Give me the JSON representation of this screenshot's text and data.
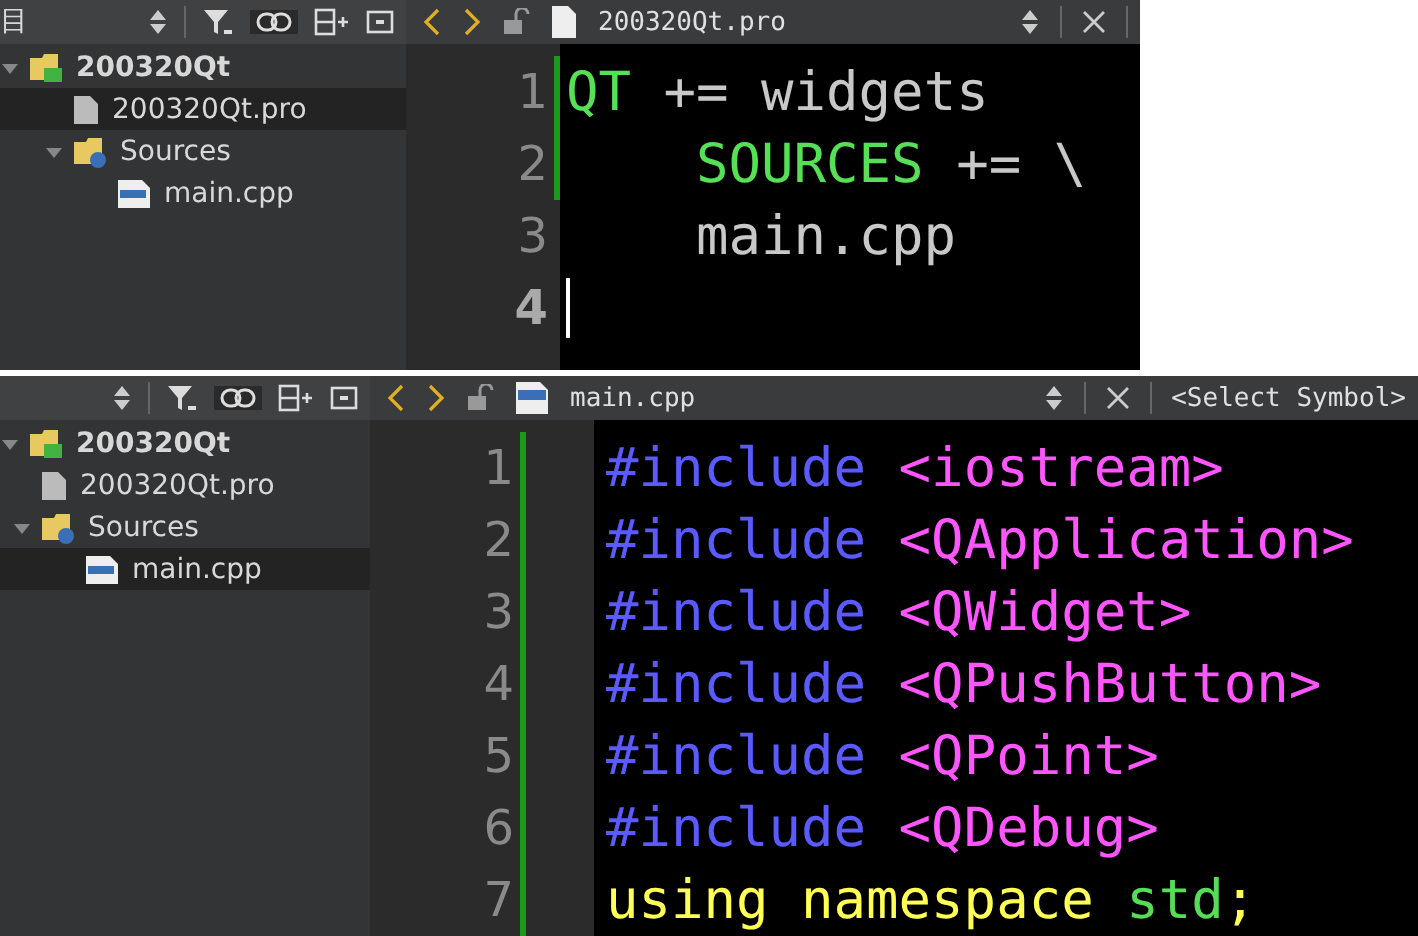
{
  "panels": [
    {
      "sidebar": {
        "title": "目",
        "tree": [
          {
            "label": "200320Qt",
            "kind": "project",
            "selected": false,
            "expanded": true,
            "children": [
              {
                "label": "200320Qt.pro",
                "kind": "pro-file",
                "selected": true
              },
              {
                "label": "Sources",
                "kind": "sources-folder",
                "selected": false,
                "expanded": true,
                "children": [
                  {
                    "label": "main.cpp",
                    "kind": "cpp-file",
                    "selected": false
                  }
                ]
              }
            ]
          }
        ]
      },
      "editor": {
        "file": "200320Qt.pro",
        "kind": "pro",
        "lines": [
          {
            "number": "1",
            "current": false,
            "modified": true,
            "segments": [
              {
                "text": "QT",
                "color": "#55e055"
              },
              {
                "text": " += widgets",
                "color": "#c8c8c8"
              }
            ]
          },
          {
            "number": "2",
            "current": false,
            "modified": true,
            "segments": [
              {
                "text": "    SOURCES",
                "color": "#55e055"
              },
              {
                "text": " += \\",
                "color": "#c8c8c8"
              }
            ]
          },
          {
            "number": "3",
            "current": false,
            "modified": false,
            "segments": [
              {
                "text": "    main.cpp",
                "color": "#c8c8c8"
              }
            ]
          },
          {
            "number": "4",
            "current": true,
            "modified": false
          }
        ]
      }
    },
    {
      "sidebar": {
        "tree": [
          {
            "label": "200320Qt",
            "kind": "project",
            "selected": false,
            "expanded": true,
            "children": [
              {
                "label": "200320Qt.pro",
                "kind": "pro-file",
                "selected": false
              },
              {
                "label": "Sources",
                "kind": "sources-folder",
                "selected": false,
                "expanded": true,
                "children": [
                  {
                    "label": "main.cpp",
                    "kind": "cpp-file",
                    "selected": true
                  }
                ]
              }
            ]
          }
        ]
      },
      "editor": {
        "file": "main.cpp",
        "kind": "cpp",
        "symbol_selector": "<Select Symbol>",
        "lines": [
          {
            "number": "1",
            "current": false,
            "modified": true,
            "segments": [
              {
                "text": "#include",
                "color": "#5a5aff"
              },
              {
                "text": " <iostream>",
                "color": "#ff55ff"
              }
            ]
          },
          {
            "number": "2",
            "current": false,
            "modified": true,
            "segments": [
              {
                "text": "#include",
                "color": "#5a5aff"
              },
              {
                "text": " <QApplication>",
                "color": "#ff55ff"
              }
            ]
          },
          {
            "number": "3",
            "current": false,
            "modified": true,
            "segments": [
              {
                "text": "#include",
                "color": "#5a5aff"
              },
              {
                "text": " <QWidget>",
                "color": "#ff55ff"
              }
            ]
          },
          {
            "number": "4",
            "current": false,
            "modified": true,
            "segments": [
              {
                "text": "#include",
                "color": "#5a5aff"
              },
              {
                "text": " <QPushButton>",
                "color": "#ff55ff"
              }
            ]
          },
          {
            "number": "5",
            "current": false,
            "modified": true,
            "segments": [
              {
                "text": "#include",
                "color": "#5a5aff"
              },
              {
                "text": " <QPoint>",
                "color": "#ff55ff"
              }
            ]
          },
          {
            "number": "6",
            "current": false,
            "modified": true,
            "segments": [
              {
                "text": "#include",
                "color": "#5a5aff"
              },
              {
                "text": " <QDebug>",
                "color": "#ff55ff"
              }
            ]
          },
          {
            "number": "7",
            "current": false,
            "modified": true,
            "segments": [
              {
                "text": "using namespace ",
                "color": "#ffff55"
              },
              {
                "text": "std",
                "color": "#55dd55"
              },
              {
                "text": ";",
                "color": "#ffff55"
              }
            ]
          }
        ]
      }
    }
  ]
}
